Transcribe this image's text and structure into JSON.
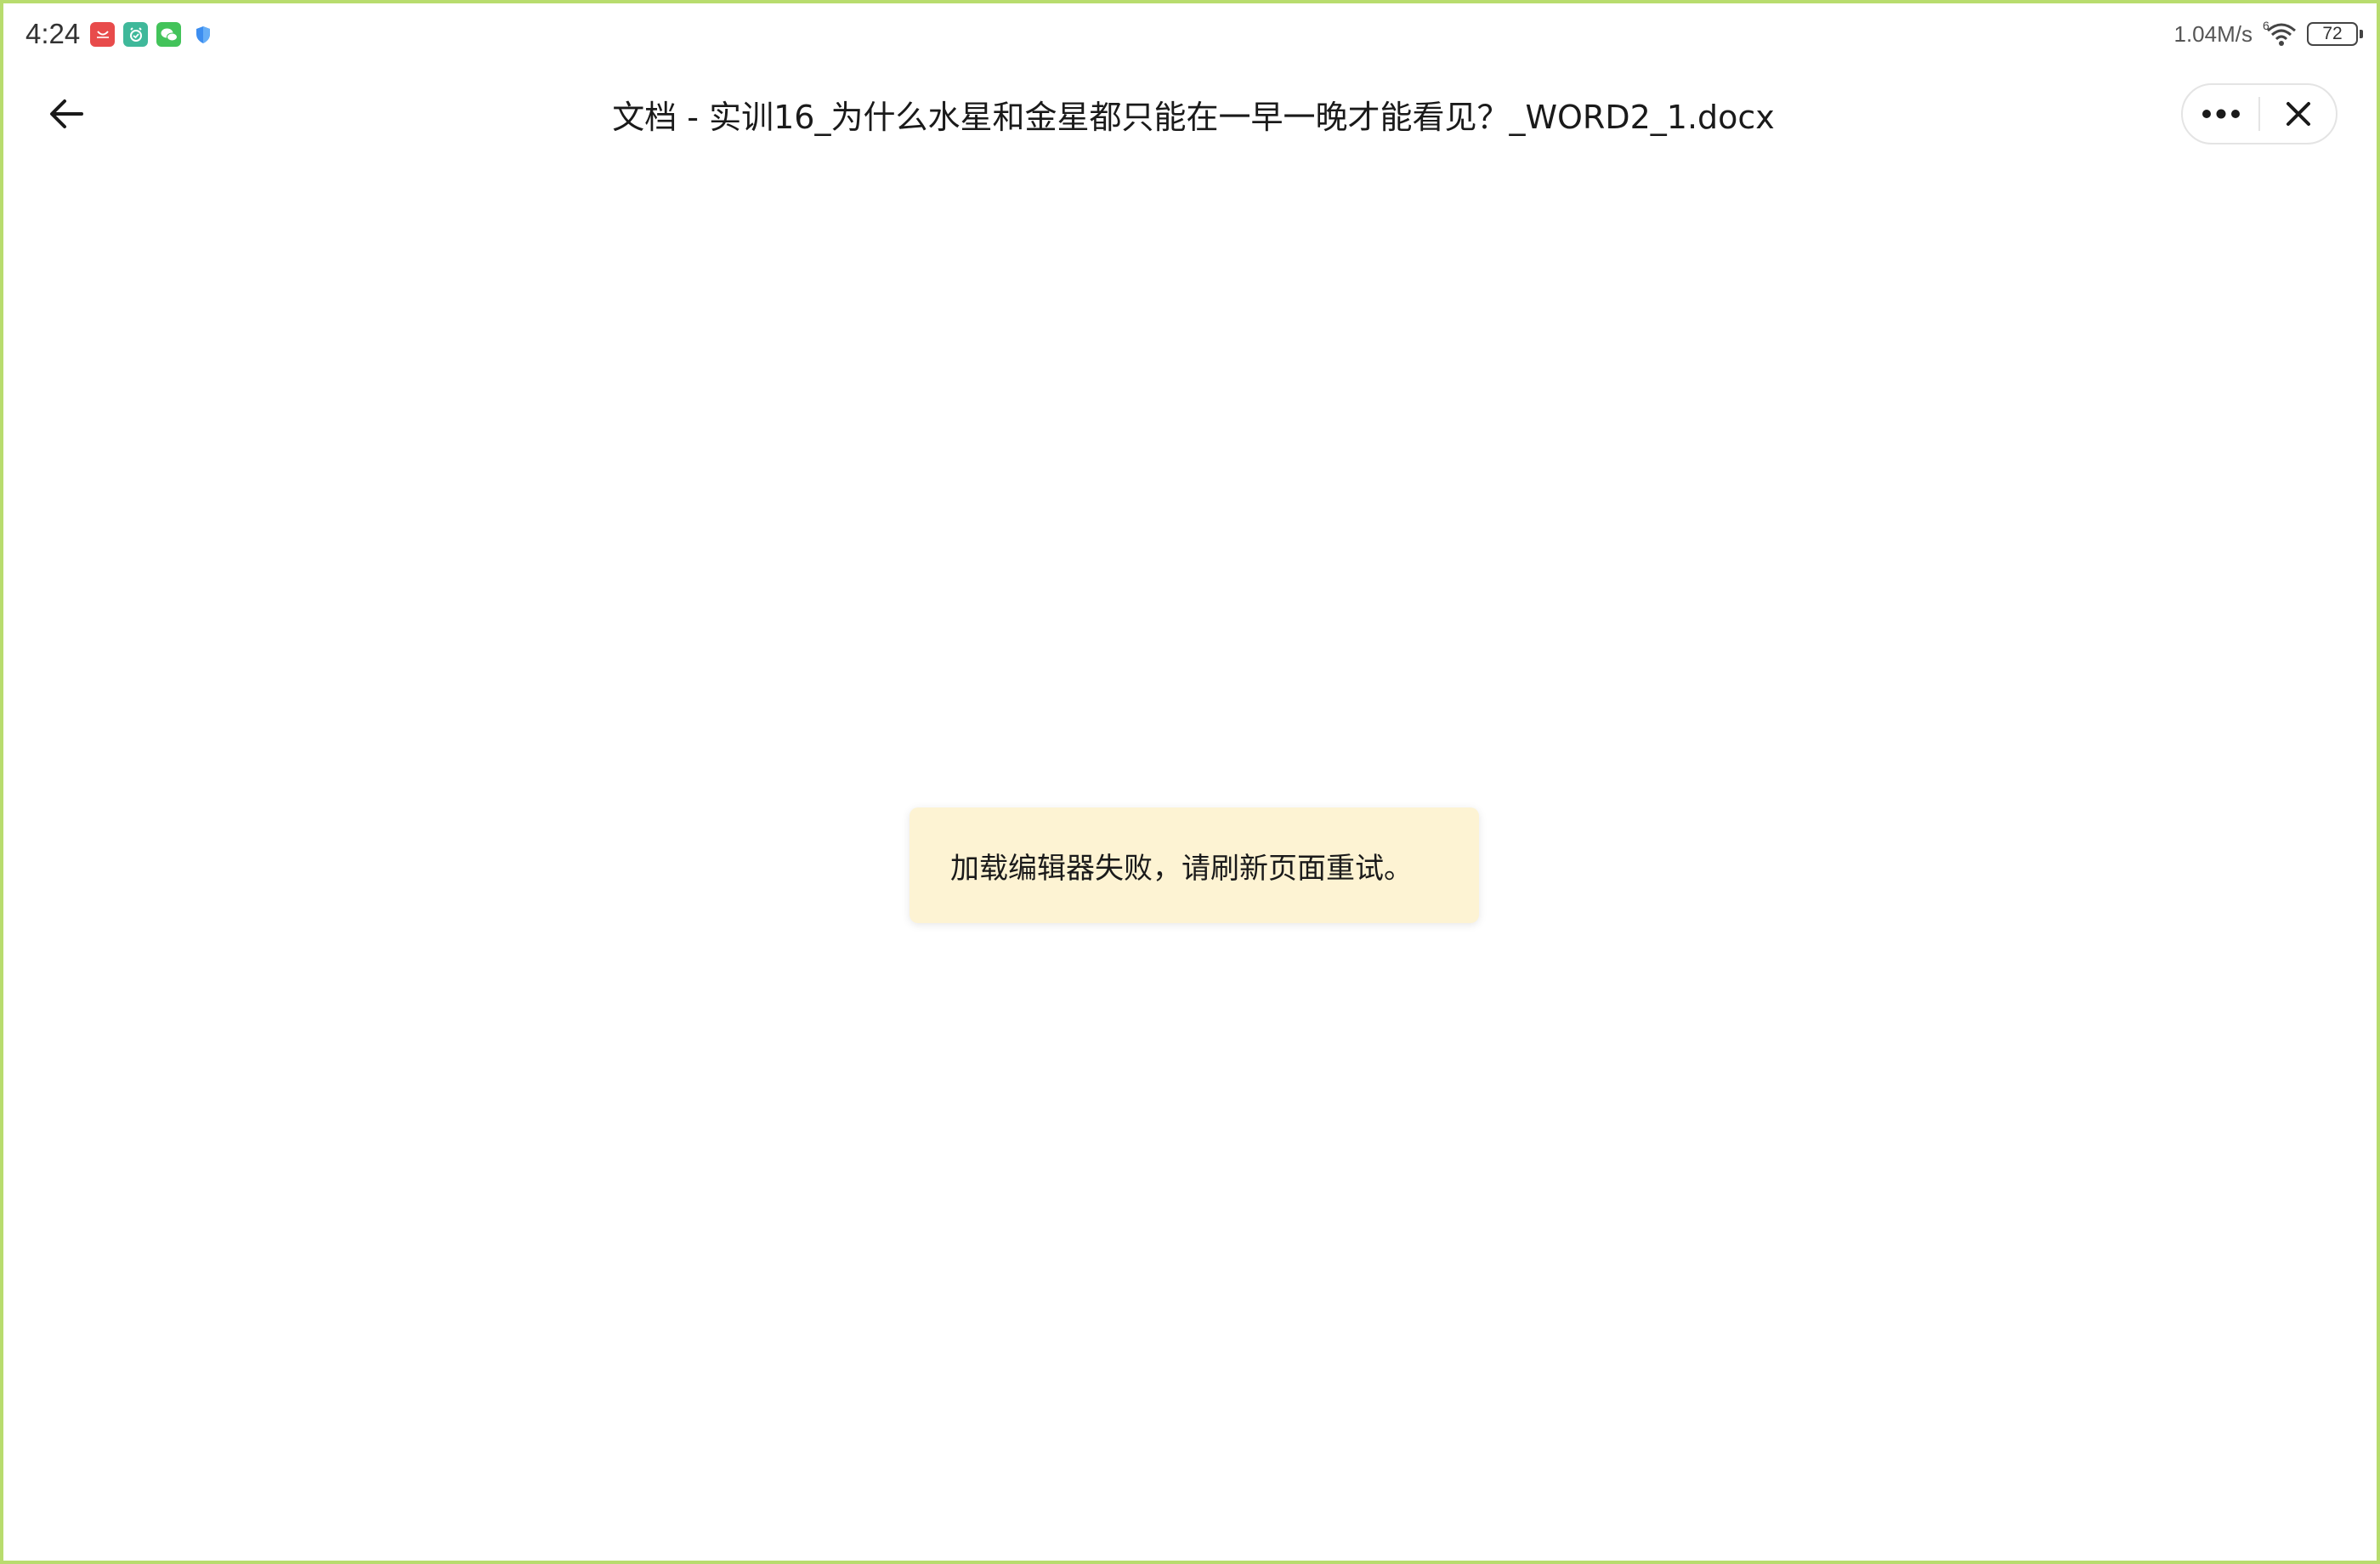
{
  "status_bar": {
    "time": "4:24",
    "apps": [
      {
        "icon": "huawei-appgallery-icon",
        "color": "#e84b4b"
      },
      {
        "icon": "alarm-timer-icon",
        "color": "#3fb89a"
      },
      {
        "icon": "wechat-icon",
        "color": "#43c35a"
      },
      {
        "icon": "shield-icon",
        "color": "#3d8ef0"
      }
    ],
    "net_speed": "1.04M/s",
    "wifi_label": "6",
    "battery": "72"
  },
  "title_bar": {
    "back_icon": "arrow-left-icon",
    "title": "文档 - 实训16_为什么水星和金星都只能在一早一晚才能看见？_WORD2_1.docx",
    "more_icon": "more-dots-icon",
    "close_icon": "close-icon"
  },
  "toast": {
    "message": "加载编辑器失败，请刷新页面重试。",
    "background": "#fdf3d3"
  },
  "colors": {
    "frame_border": "#b8dc6e",
    "background": "#ffffff"
  }
}
